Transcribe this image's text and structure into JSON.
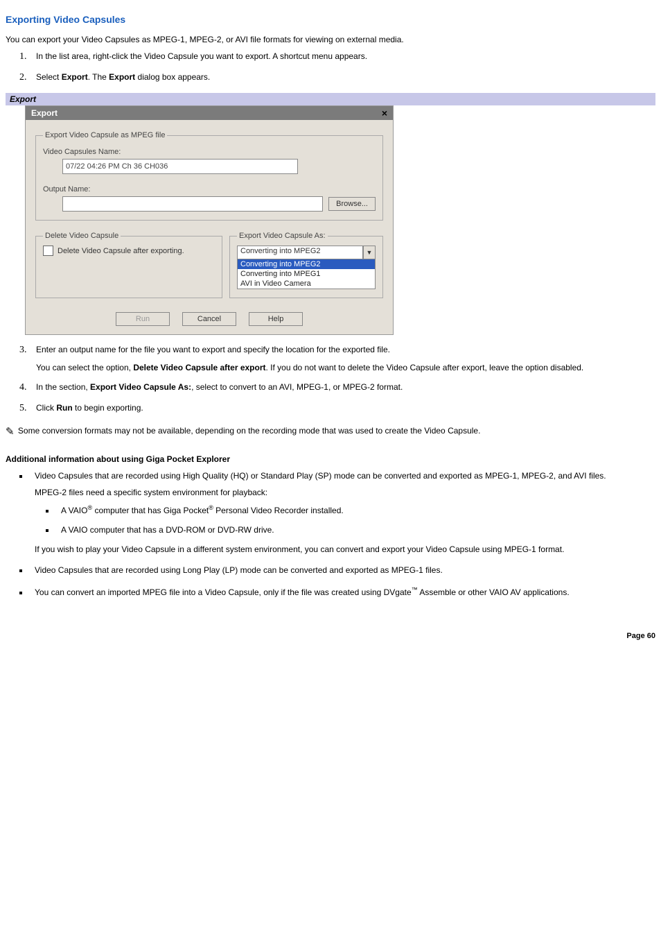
{
  "title": "Exporting Video Capsules",
  "intro": "You can export your Video Capsules as MPEG-1, MPEG-2, or AVI file formats for viewing on external media.",
  "steps12": {
    "s1": "In the list area, right-click the Video Capsule you want to export. A shortcut menu appears.",
    "s2_a": "Select ",
    "s2_b": "Export",
    "s2_c": ". The ",
    "s2_d": "Export",
    "s2_e": " dialog box appears."
  },
  "caption": "Export",
  "dialog": {
    "title": "Export",
    "group1_legend": "Export Video Capsule as MPEG file",
    "vcn_label": "Video Capsules Name:",
    "vcn_value": "07/22 04:26 PM Ch 36 CH036",
    "out_label": "Output Name:",
    "out_value": "",
    "browse": "Browse...",
    "del_legend": "Delete Video Capsule",
    "del_chk": "Delete Video Capsule after exporting.",
    "as_legend": "Export Video Capsule As:",
    "combo_value": "Converting into MPEG2",
    "opts": {
      "o1": "Converting into MPEG2",
      "o2": "Converting into MPEG1",
      "o3": "AVI in Video Camera"
    },
    "run": "Run",
    "cancel": "Cancel",
    "help": "Help"
  },
  "steps345": {
    "s3": "Enter an output name for the file you want to export and specify the location for the exported file.",
    "s3p_a": "You can select the option, ",
    "s3p_b": "Delete Video Capsule after export",
    "s3p_c": ". If you do not want to delete the Video Capsule after export, leave the option disabled.",
    "s4_a": "In the section, ",
    "s4_b": "Export Video Capsule As:",
    "s4_c": ", select to convert to an AVI, MPEG-1, or MPEG-2 format.",
    "s5_a": "Click ",
    "s5_b": "Run",
    "s5_c": " to begin exporting."
  },
  "note": " Some conversion formats may not be available, depending on the recording mode that was used to create the Video Capsule.",
  "addl_head": "Additional information about using Giga Pocket Explorer",
  "addl": {
    "b1a": "Video Capsules that are recorded using High Quality (HQ) or Standard Play (SP) mode can be converted and exported as MPEG-1, MPEG-2, and AVI files.",
    "b1b": "MPEG-2 files need a specific system environment for playback:",
    "b1c_1a": "A VAIO",
    "b1c_1b": " computer that has Giga Pocket",
    "b1c_1c": " Personal Video Recorder installed.",
    "b1c_2": "A VAIO computer that has a DVD-ROM or DVD-RW drive.",
    "b1d": "If you wish to play your Video Capsule in a different system environment, you can convert and export your Video Capsule using MPEG-1 format.",
    "b2": "Video Capsules that are recorded using Long Play (LP) mode can be converted and exported as MPEG-1 files.",
    "b3a": "You can convert an imported MPEG file into a Video Capsule, only if the file was created using DVgate",
    "b3b": " Assemble or other VAIO AV applications."
  },
  "page": "Page 60"
}
